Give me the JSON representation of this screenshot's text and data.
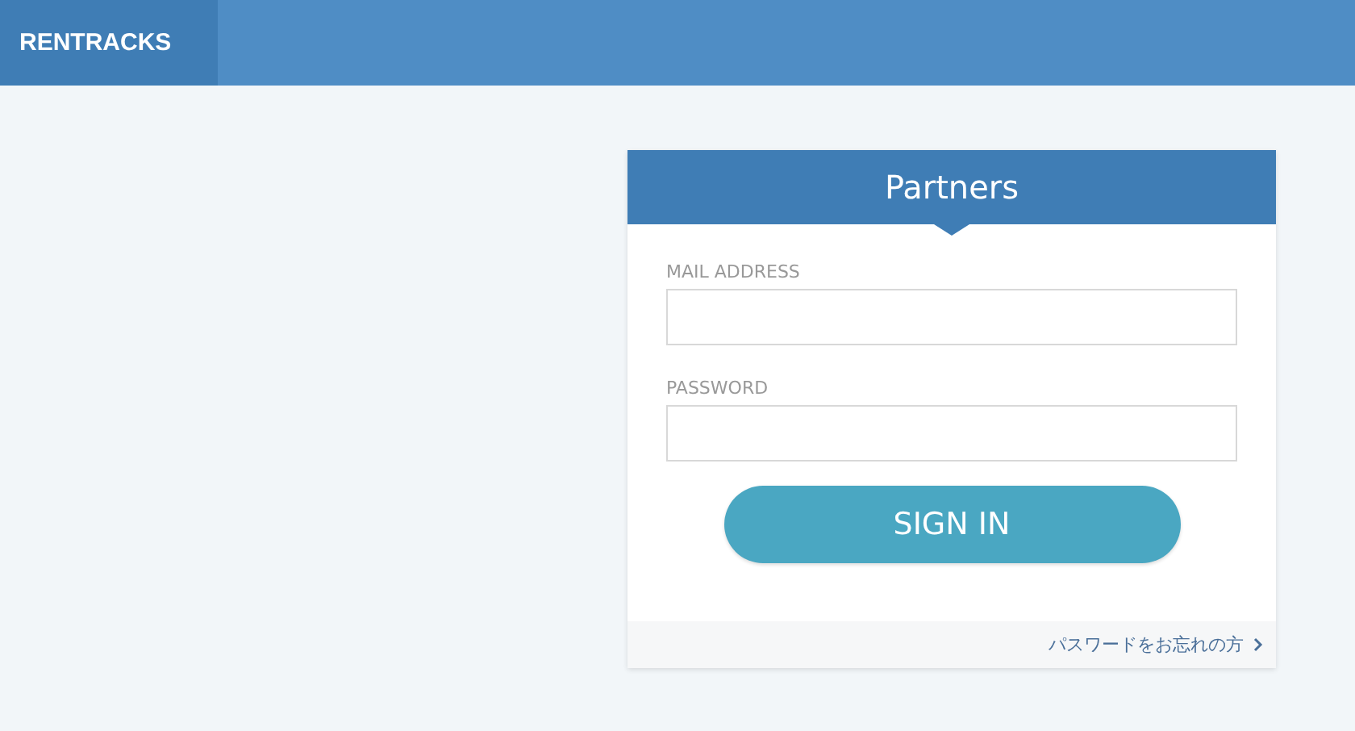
{
  "header": {
    "logo": "RENTRACKS"
  },
  "login": {
    "title": "Partners",
    "fields": [
      {
        "label": "MAIL ADDRESS"
      },
      {
        "label": "PASSWORD"
      }
    ],
    "button": "SIGN IN",
    "forgot_link": "パスワードをお忘れの方"
  }
}
